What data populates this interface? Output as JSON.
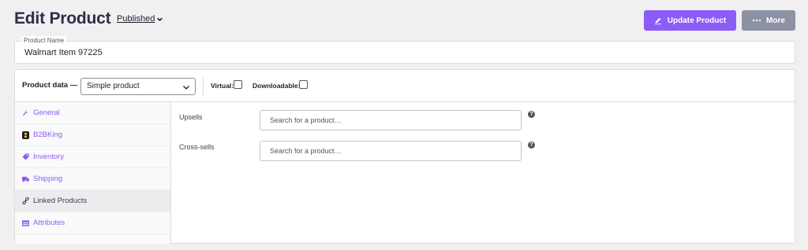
{
  "header": {
    "title": "Edit Product",
    "separator": "-",
    "status": "Published",
    "update_button": "Update Product",
    "more_button": "More"
  },
  "product_name": {
    "label": "Product Name",
    "value": "Walmart Item 97225"
  },
  "product_data": {
    "label": "Product data —",
    "type_selected": "Simple product",
    "virtual_label": "Virtual:",
    "virtual_checked": false,
    "downloadable_label": "Downloadable:",
    "downloadable_checked": false
  },
  "tabs": [
    {
      "label": "General",
      "icon": "wrench-icon",
      "active": false
    },
    {
      "label": "B2BKing",
      "icon": "b2bking-logo-icon",
      "active": false
    },
    {
      "label": "Inventory",
      "icon": "tag-icon",
      "active": false
    },
    {
      "label": "Shipping",
      "icon": "truck-icon",
      "active": false
    },
    {
      "label": "Linked Products",
      "icon": "link-icon",
      "active": true
    },
    {
      "label": "Attributes",
      "icon": "table-icon",
      "active": false
    }
  ],
  "linked_products": {
    "upsells_label": "Upsells",
    "upsells_placeholder": "Search for a product…",
    "crosssells_label": "Cross-sells",
    "crosssells_placeholder": "Search for a product…",
    "help_glyph": "?"
  },
  "colors": {
    "accent": "#8b5cf6",
    "more_button": "#8c92a4",
    "active_tab_bg": "#ececee"
  }
}
